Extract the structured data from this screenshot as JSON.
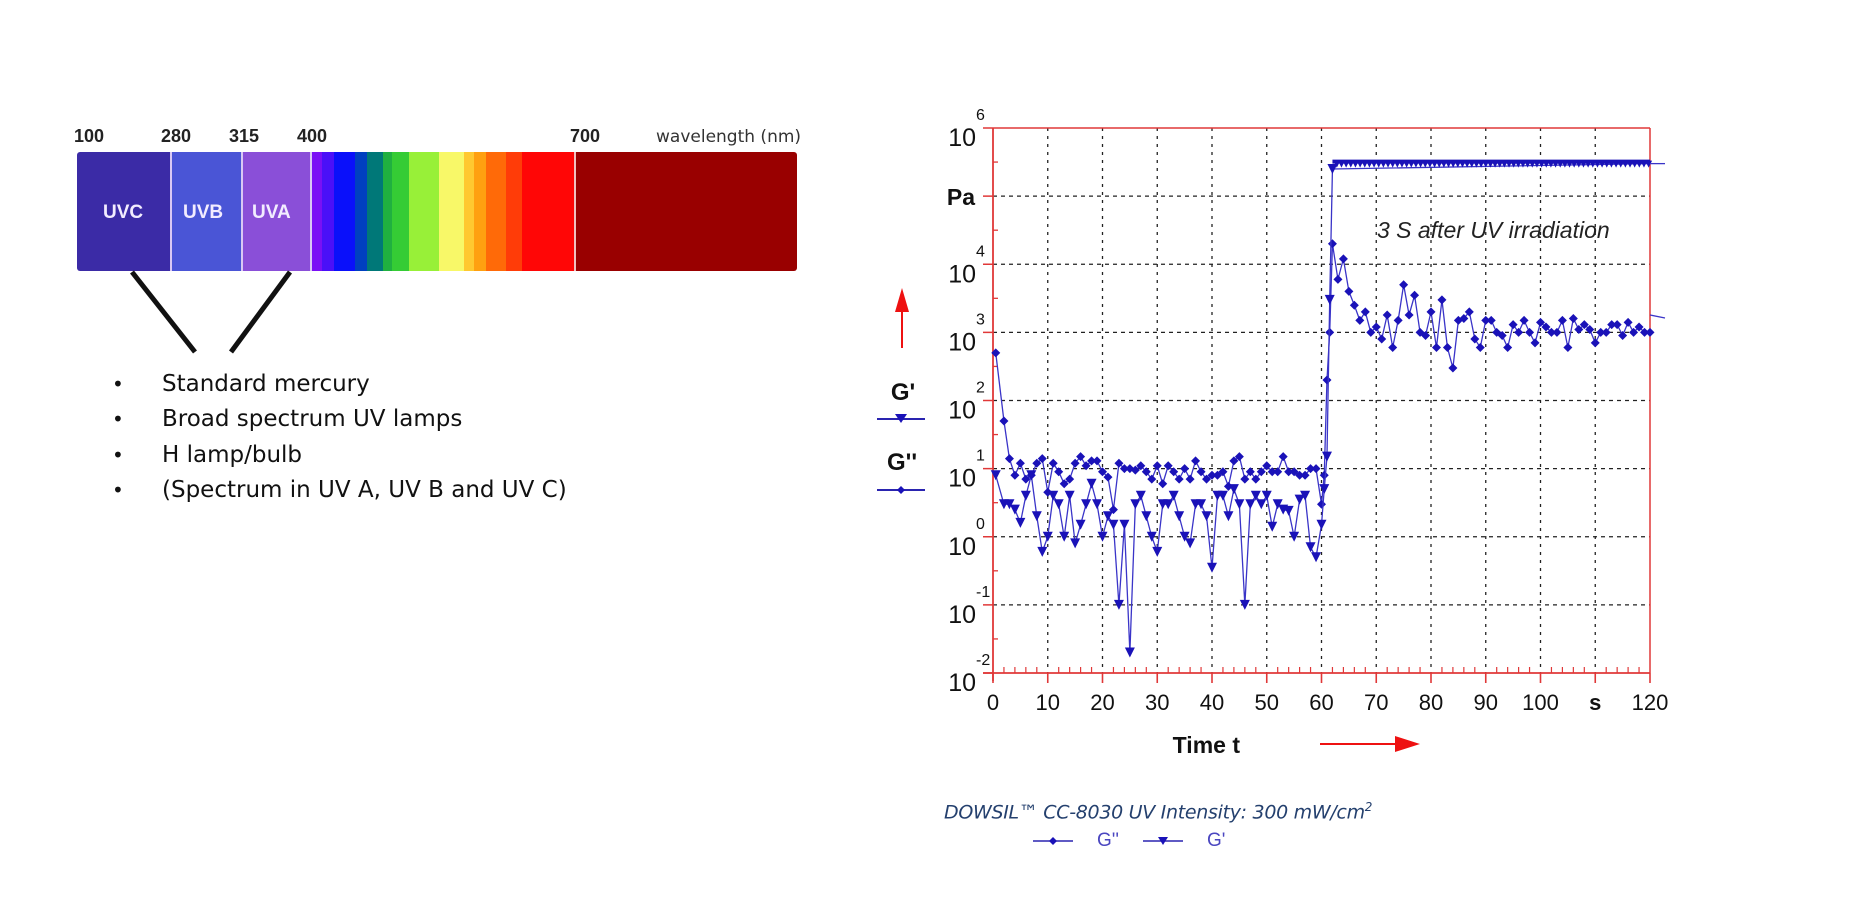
{
  "spectrum": {
    "ticks": [
      {
        "label": "100"
      },
      {
        "label": "280"
      },
      {
        "label": "315"
      },
      {
        "label": "400"
      },
      {
        "label": "700"
      }
    ],
    "unit_label": "wavelength (nm)",
    "bands": [
      {
        "name": "UVC",
        "color": "#3b2ba6"
      },
      {
        "name": "UVB",
        "color": "#4a55d6"
      },
      {
        "name": "UVA",
        "color": "#8a4fd8"
      }
    ],
    "visible_colors": [
      "#7a10f5",
      "#4a10f8",
      "#0a10fa",
      "#0040c0",
      "#007878",
      "#20b040",
      "#35cc35",
      "#98f038",
      "#f8f868",
      "#ffc830",
      "#ffa010",
      "#ff6a08",
      "#ff3c08",
      "#ff0606",
      "#990000"
    ]
  },
  "bullets": [
    "Standard mercury",
    "Broad spectrum UV lamps",
    "H lamp/bulb",
    "(Spectrum in UV A, UV B and UV C)"
  ],
  "chart_data": {
    "type": "line",
    "title": "",
    "annotation": "3 S after UV irradiation",
    "xlabel": "Time t",
    "x_unit": "s",
    "ylabel_unit": "Pa",
    "y_scale": "log",
    "xlim": [
      0,
      120
    ],
    "ylim": [
      0.01,
      1000000
    ],
    "x_ticks": [
      0,
      10,
      20,
      30,
      40,
      50,
      60,
      70,
      80,
      90,
      100,
      120
    ],
    "y_tick_exponents": [
      -2,
      -1,
      0,
      1,
      2,
      3,
      4,
      6
    ],
    "grid": true,
    "axis_color": "#e03838",
    "series_color": "#1a12b8",
    "left_legend": [
      "G'",
      "G''"
    ],
    "series": [
      {
        "name": "G''",
        "marker": "diamond",
        "x": [
          0.5,
          2,
          3,
          4,
          5,
          6,
          7,
          8,
          9,
          10,
          11,
          12,
          13,
          14,
          15,
          16,
          17,
          18,
          19,
          20,
          21,
          22,
          23,
          24,
          25,
          26,
          27,
          28,
          29,
          30,
          31,
          32,
          33,
          34,
          35,
          36,
          37,
          38,
          39,
          40,
          41,
          42,
          43,
          44,
          45,
          46,
          47,
          48,
          49,
          50,
          51,
          52,
          53,
          54,
          55,
          56,
          57,
          58,
          59,
          60,
          60.5,
          61,
          61.5,
          62,
          63,
          64,
          65,
          66,
          67,
          68,
          69,
          70,
          71,
          72,
          73,
          74,
          75,
          76,
          77,
          78,
          79,
          80,
          81,
          82,
          83,
          84,
          85,
          86,
          87,
          88,
          89,
          90,
          91,
          92,
          93,
          94,
          95,
          96,
          97,
          98,
          99,
          100,
          101,
          102,
          103,
          104,
          105,
          106,
          107,
          108,
          109,
          110,
          111,
          112,
          113,
          114,
          115,
          116,
          117,
          118,
          119,
          120
        ],
        "y": [
          500,
          50,
          14,
          8,
          12,
          7,
          8,
          12,
          14,
          4.5,
          12,
          9,
          6,
          7,
          12,
          15,
          11,
          13,
          13,
          9,
          7.5,
          2.5,
          12,
          10,
          10,
          9.5,
          11,
          9,
          7,
          11,
          6,
          11,
          9,
          7,
          10,
          7,
          13,
          9,
          7,
          8,
          8,
          9,
          5.5,
          13,
          15,
          7,
          9,
          7,
          9,
          11,
          9,
          9,
          15,
          9,
          9,
          8,
          8,
          10,
          10,
          3,
          8,
          200,
          1000,
          20000,
          6000,
          12000,
          4000,
          2500,
          1500,
          2000,
          1000,
          1200,
          800,
          1800,
          600,
          1500,
          5000,
          1800,
          3500,
          1000,
          900,
          2000,
          600,
          3000,
          600,
          300,
          1500,
          1600,
          2000,
          800,
          600,
          1500,
          1500,
          1000,
          900,
          600,
          1300,
          1000,
          1500,
          1000,
          700,
          1400,
          1200,
          1000,
          1000,
          1500,
          600,
          1600,
          1100,
          1300,
          1100,
          700,
          1000,
          1000,
          1300,
          1300,
          900,
          1400,
          1000,
          1200,
          1000,
          1000,
          1600,
          1500,
          1300,
          1400,
          1100,
          1800
        ]
      },
      {
        "name": "G'",
        "marker": "triangle-down",
        "x": [
          0.5,
          2,
          3,
          4,
          5,
          6,
          7,
          8,
          9,
          10,
          11,
          12,
          13,
          14,
          15,
          16,
          17,
          18,
          19,
          20,
          21,
          22,
          23,
          24,
          25,
          26,
          27,
          28,
          29,
          30,
          31,
          32,
          33,
          34,
          35,
          36,
          37,
          38,
          39,
          40,
          41,
          42,
          43,
          44,
          45,
          46,
          47,
          48,
          49,
          50,
          51,
          52,
          53,
          54,
          55,
          56,
          57,
          58,
          59,
          60,
          60.5,
          61,
          61.5,
          62,
          120
        ],
        "y": [
          8,
          3,
          3,
          2.5,
          1.6,
          4,
          8,
          2,
          0.6,
          1,
          4,
          3,
          1,
          4,
          0.8,
          1.5,
          3,
          6,
          3,
          1,
          2,
          1.5,
          0.1,
          1.5,
          0.02,
          3,
          4,
          2,
          1,
          0.6,
          3,
          3,
          4,
          2,
          1,
          0.8,
          3,
          3,
          2,
          0.35,
          4,
          4,
          2,
          5,
          3,
          0.1,
          3,
          4,
          3,
          4,
          1.4,
          3,
          2.5,
          2.4,
          1,
          3.5,
          4,
          0.7,
          0.5,
          1.5,
          5,
          15,
          3000,
          250000,
          300000
        ]
      }
    ],
    "caption": "DOWSIL™ CC-8030 UV Intensity: 300 mW/cm",
    "caption_sup": "2",
    "bottom_legend": [
      "G''",
      "G'"
    ]
  }
}
